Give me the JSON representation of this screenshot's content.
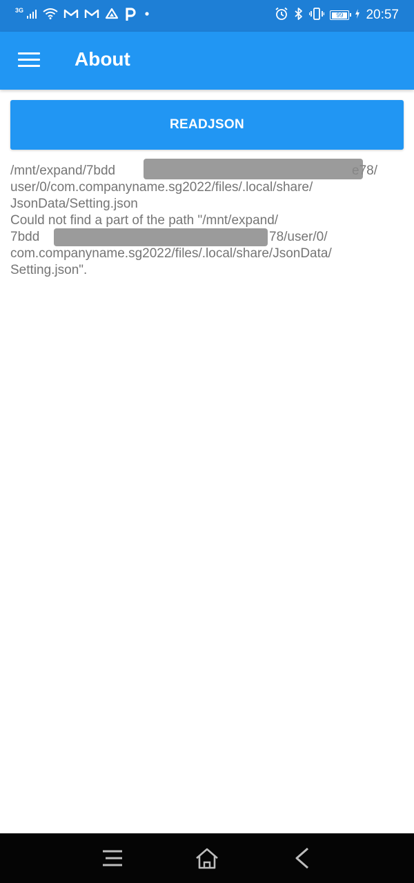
{
  "status_bar": {
    "network_type": "3G",
    "battery_level": "99",
    "time": "20:57"
  },
  "app_bar": {
    "title": "About"
  },
  "button": {
    "label": "READJSON"
  },
  "output": {
    "lines": [
      "/mnt/expand/7bdd",
      "e78/",
      "user/0/com.companyname.sg2022/files/.local/share/",
      "JsonData/Setting.json",
      "Could not find a part of the path \"/mnt/expand/",
      "7bdd",
      "78/user/0/",
      "com.companyname.sg2022/files/.local/share/JsonData/",
      "Setting.json\"."
    ]
  }
}
